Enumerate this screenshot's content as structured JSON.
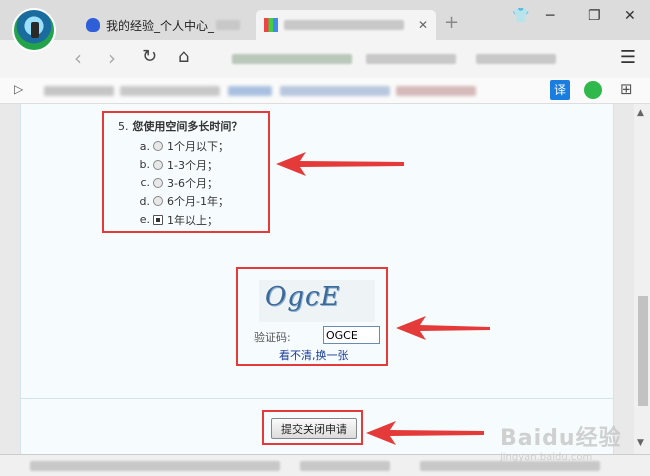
{
  "browser": {
    "tabs": [
      {
        "title": "我的经验_个人中心_"
      },
      {
        "title": ""
      }
    ],
    "translate_label": "译"
  },
  "survey": {
    "question_number": "5.",
    "question_text": "您使用空间多长时间？",
    "options": [
      {
        "letter": "a.",
        "label": "1个月以下；",
        "selected": false
      },
      {
        "letter": "b.",
        "label": "1-3个月；",
        "selected": false
      },
      {
        "letter": "c.",
        "label": "3-6个月；",
        "selected": false
      },
      {
        "letter": "d.",
        "label": "6个月-1年；",
        "selected": false
      },
      {
        "letter": "e.",
        "label": "1年以上；",
        "selected": true
      }
    ]
  },
  "captcha": {
    "image_text": "OgcE",
    "label": "验证码:",
    "value": "OGCE",
    "refresh_link": "看不清,换一张"
  },
  "submit_label": "提交关闭申请",
  "watermark": {
    "main": "Baidu经验",
    "sub": "jingyan.baidu.com"
  },
  "colors": {
    "highlight": "#e43a3a",
    "link": "#1a3c9c"
  }
}
